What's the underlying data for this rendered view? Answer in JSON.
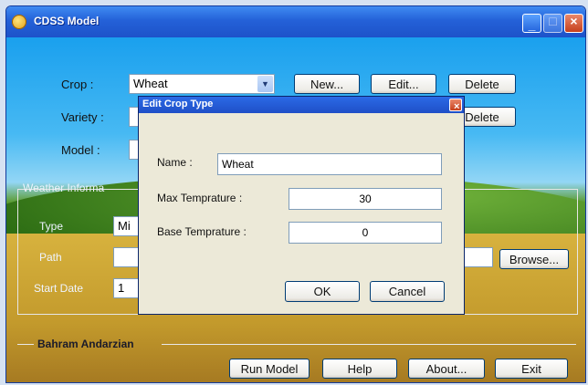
{
  "window": {
    "title": "CDSS Model"
  },
  "form": {
    "crop_label": "Crop :",
    "crop_value": "Wheat",
    "variety_label": "Variety :",
    "model_label": "Model :",
    "new_button": "New...",
    "edit_button": "Edit...",
    "delete_button": "Delete",
    "delete_button_2": "Delete"
  },
  "weather_group": {
    "title": "Weather Informa",
    "type_label": "Type",
    "type_value": "Mi",
    "path_label": "Path",
    "start_date_label": "Start Date",
    "start_date_value": "1",
    "browse_button": "Browse..."
  },
  "dialog": {
    "title": "Edit Crop Type",
    "name_label": "Name :",
    "name_value": "Wheat",
    "max_temp_label": "Max Temprature :",
    "max_temp_value": "30",
    "base_temp_label": "Base Temprature :",
    "base_temp_value": "0",
    "ok_button": "OK",
    "cancel_button": "Cancel"
  },
  "footer": {
    "author": "Bahram Andarzian",
    "run_button": "Run Model",
    "help_button": "Help",
    "about_button": "About...",
    "exit_button": "Exit"
  }
}
